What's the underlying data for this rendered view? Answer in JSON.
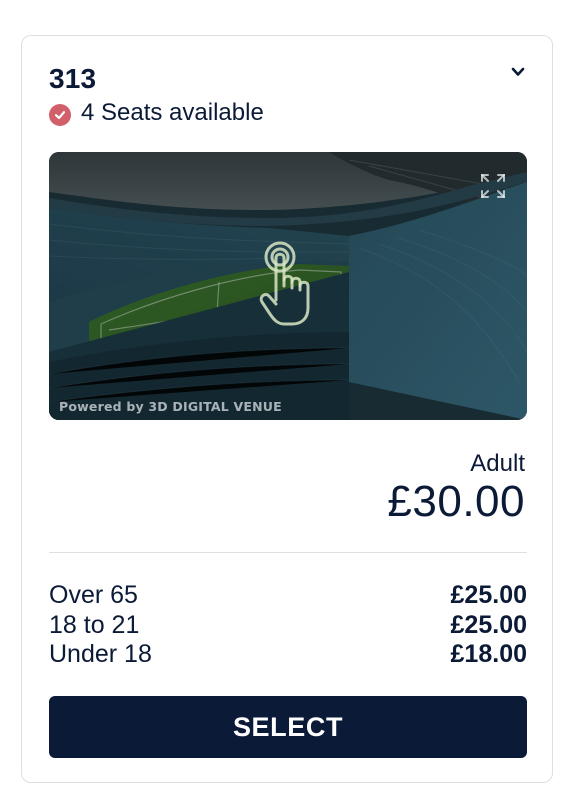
{
  "section": {
    "title": "313",
    "availability": "4 Seats available"
  },
  "venue_view": {
    "powered_by": "Powered by 3D DIGITAL VENUE"
  },
  "pricing": {
    "main_label": "Adult",
    "main_price": "£30.00",
    "concessions": [
      {
        "label": "Over 65",
        "price": "£25.00"
      },
      {
        "label": "18 to 21",
        "price": "£25.00"
      },
      {
        "label": "Under 18",
        "price": "£18.00"
      }
    ]
  },
  "actions": {
    "select_label": "SELECT"
  },
  "colors": {
    "navy": "#0b1a36",
    "availability_check": "#d1606a",
    "border": "#dcdfe4"
  },
  "icons": {
    "collapse": "chevron-down-icon",
    "availability": "check-circle-icon",
    "expand": "expand-icon",
    "tap": "tap-hand-icon"
  }
}
